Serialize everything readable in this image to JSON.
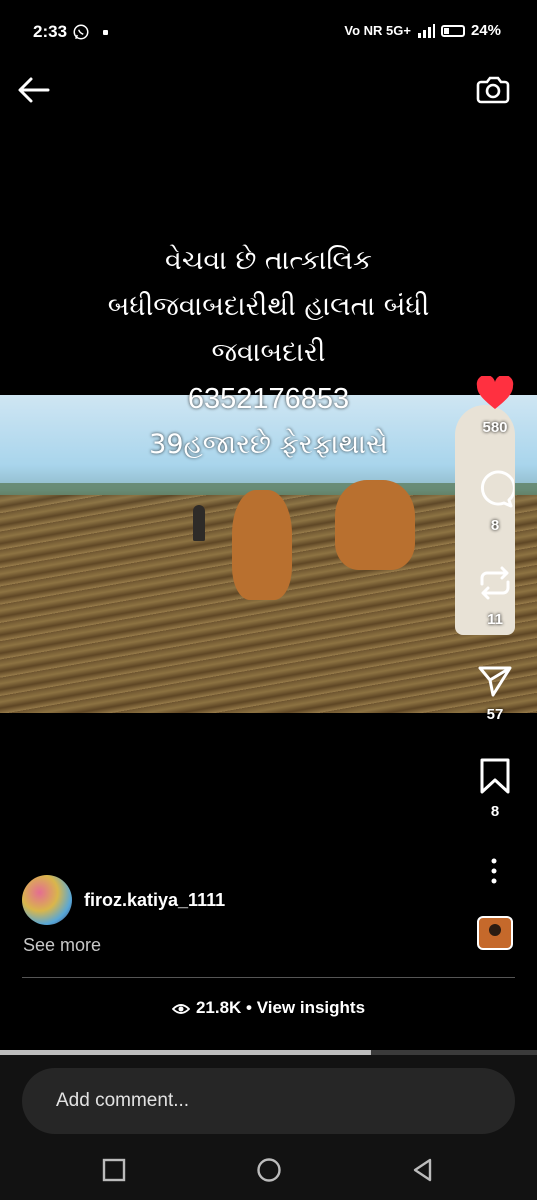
{
  "status_bar": {
    "time": "2:33",
    "network": "Vo NR 5G+",
    "battery": "24%",
    "icons": [
      "whatsapp-icon",
      "notification-dot-icon",
      "signal-icon",
      "battery-icon"
    ]
  },
  "header": {
    "back_icon": "arrow-left-icon",
    "camera_icon": "camera-icon"
  },
  "caption": {
    "line1": "વેચવા છે તાત્કાલિક",
    "line2": "બધીજવાબદારીથી હાલતા બંધી",
    "line3": "જવાબદારી",
    "phone": "6352176853",
    "line5": "39હજારછે ફેરફાથાસે"
  },
  "actions": {
    "likes": "580",
    "comments": "8",
    "reposts": "11",
    "shares": "57",
    "saves": "8",
    "like_color": "#ff3040",
    "icons": [
      "heart-icon",
      "comment-icon",
      "repost-icon",
      "share-icon",
      "bookmark-icon",
      "more-icon"
    ]
  },
  "author": {
    "username": "firoz.katiya_1111",
    "see_more": "See more"
  },
  "insights": {
    "text": "21.8K • View insights",
    "icon": "eye-icon"
  },
  "progress": {
    "fraction": 0.69
  },
  "comment": {
    "placeholder": "Add comment..."
  },
  "navbar": {
    "icons": [
      "recents-square-icon",
      "home-circle-icon",
      "back-triangle-icon"
    ]
  }
}
